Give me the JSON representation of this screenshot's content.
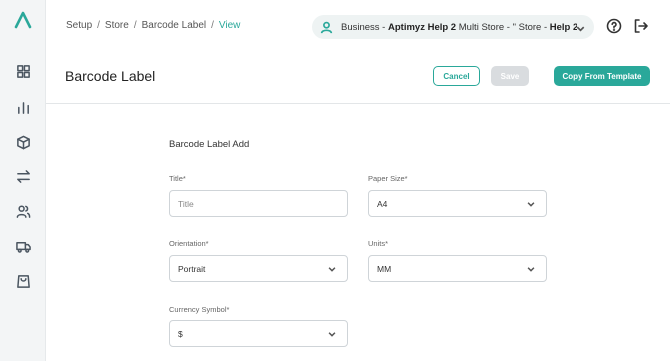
{
  "sidebar": {
    "icons": [
      "logo",
      "dashboard-icon",
      "reports-icon",
      "products-icon",
      "transfer-icon",
      "users-icon",
      "delivery-icon",
      "shopping-bag-icon"
    ]
  },
  "breadcrumb": {
    "items": [
      "Setup",
      "Store",
      "Barcode Label"
    ],
    "current": "View",
    "separator": "/"
  },
  "business": {
    "prefix": "Business - ",
    "name": "Aptimyz Help 2",
    "middle": " Multi Store - \" Store - ",
    "store": "Help 2"
  },
  "header": {
    "title": "Barcode Label",
    "cancel_label": "Cancel",
    "save_label": "Save",
    "copy_label": "Copy From Template"
  },
  "form": {
    "title": "Barcode Label Add",
    "title_field": {
      "label": "Title*",
      "placeholder": "Title",
      "value": ""
    },
    "paper_size": {
      "label": "Paper Size*",
      "value": "A4"
    },
    "orientation": {
      "label": "Orientation*",
      "value": "Portrait"
    },
    "units": {
      "label": "Units*",
      "value": "MM"
    },
    "currency_symbol": {
      "label": "Currency Symbol*",
      "value": "$"
    }
  },
  "colors": {
    "accent": "#2aa89a",
    "disabled": "#d9dcdf",
    "sidebar_bg": "#f3f5f6"
  }
}
